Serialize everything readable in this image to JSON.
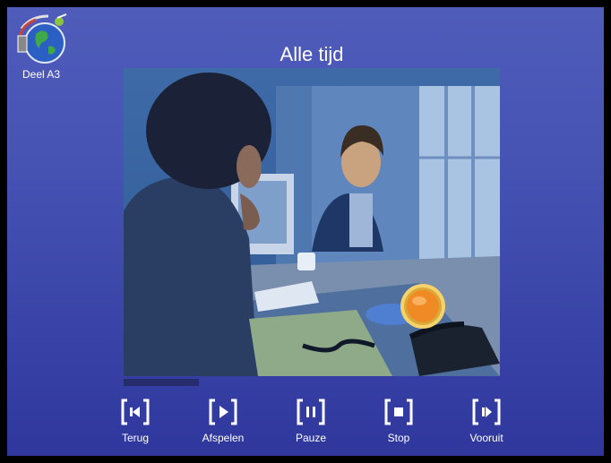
{
  "app": {
    "module_label": "Deel A3",
    "title": "Alle tijd"
  },
  "video": {
    "progress": 0.2,
    "overlay_button_icon": "orange-round-button-icon"
  },
  "controls": [
    {
      "label": "Terug",
      "icon": "step-back-icon"
    },
    {
      "label": "Afspelen",
      "icon": "play-icon"
    },
    {
      "label": "Pauze",
      "icon": "pause-icon"
    },
    {
      "label": "Stop",
      "icon": "stop-icon"
    },
    {
      "label": "Vooruit",
      "icon": "step-forward-icon"
    }
  ],
  "colors": {
    "background": "#4653b3",
    "text": "#ffffff",
    "accent": "#f08a24"
  }
}
